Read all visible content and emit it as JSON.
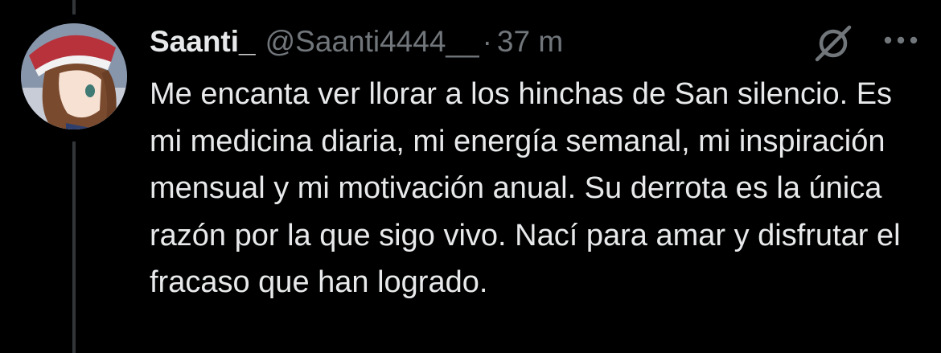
{
  "tweet": {
    "display_name": "Saanti_",
    "handle": "@Saanti4444__",
    "separator": "·",
    "timestamp": "37 m",
    "text": "Me encanta ver llorar a los hinchas de San silencio. Es mi medicina diaria, mi energía semanal, mi inspiración mensual y mi motivación anual. Su derrota es la única razón por la que sigo vivo. Nací para amar y disfrutar el fracaso que han logrado."
  },
  "icons": {
    "avatar": "anime-avatar-image",
    "mute": "grok-icon",
    "more": "more-icon"
  },
  "colors": {
    "background": "#000000",
    "text_primary": "#e7e9ea",
    "text_secondary": "#71767b",
    "thread_line": "#333639"
  }
}
